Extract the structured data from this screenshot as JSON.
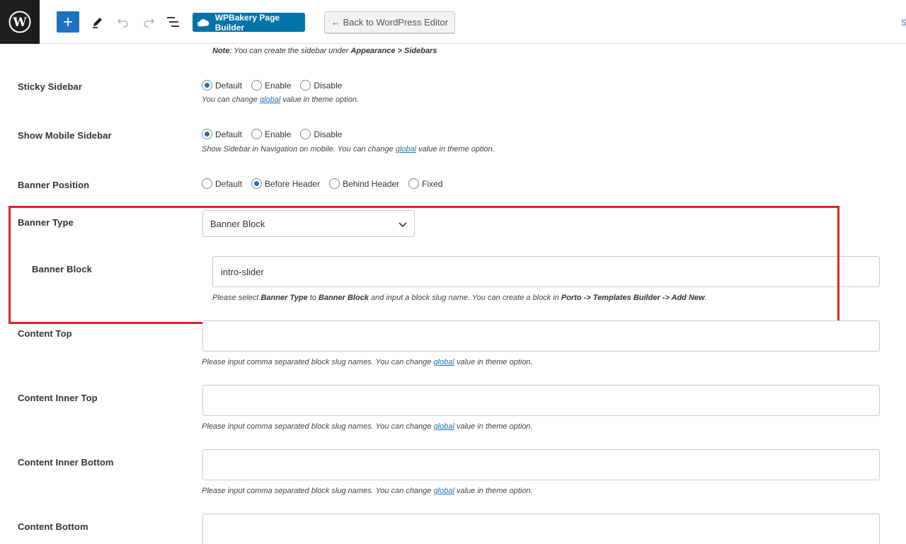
{
  "toolbar": {
    "wpbakery_label": "WPBakery Page Builder",
    "back_label": "← Back to WordPress Editor",
    "edge_text": "S",
    "colors": {
      "add_button": "#1e73be",
      "wpbakery": "#0473aa",
      "logo_bg": "#1e1e1e"
    }
  },
  "note": {
    "prefix": "Note",
    "text": ": You can create the sidebar under ",
    "path": "Appearance > Sidebars"
  },
  "sticky_sidebar": {
    "label": "Sticky Sidebar",
    "options": [
      "Default",
      "Enable",
      "Disable"
    ],
    "selected": "Default",
    "desc_before": "You can change ",
    "desc_link": "global",
    "desc_after": " value in theme option."
  },
  "mobile_sidebar": {
    "label": "Show Mobile Sidebar",
    "options": [
      "Default",
      "Enable",
      "Disable"
    ],
    "selected": "Default",
    "desc_before": "Show Sidebar in Navigation on mobile. You can change ",
    "desc_link": "global",
    "desc_after": " value in theme option."
  },
  "banner_position": {
    "label": "Banner Position",
    "options": [
      "Default",
      "Before Header",
      "Behind Header",
      "Fixed"
    ],
    "selected": "Before Header"
  },
  "banner_type": {
    "label": "Banner Type",
    "value": "Banner Block"
  },
  "banner_block": {
    "label": "Banner Block",
    "value": "intro-slider",
    "desc_1": "Please select ",
    "desc_b1": "Banner Type",
    "desc_2": " to ",
    "desc_b2": "Banner Block",
    "desc_3": " and input a block slug name. You can create a block in ",
    "desc_b3": "Porto -> Templates Builder -> Add New",
    "desc_4": "."
  },
  "content_top": {
    "label": "Content Top",
    "value": "",
    "desc_before": "Please input comma separated block slug names. You can change ",
    "desc_link": "global",
    "desc_after": " value in theme option."
  },
  "content_inner_top": {
    "label": "Content Inner Top",
    "value": "",
    "desc_before": "Please input comma separated block slug names. You can change ",
    "desc_link": "global",
    "desc_after": " value in theme option."
  },
  "content_inner_bottom": {
    "label": "Content Inner Bottom",
    "value": "",
    "desc_before": "Please input comma separated block slug names. You can change ",
    "desc_link": "global",
    "desc_after": " value in theme option."
  },
  "content_bottom": {
    "label": "Content Bottom",
    "value": ""
  },
  "highlight_color": "#e3212d"
}
